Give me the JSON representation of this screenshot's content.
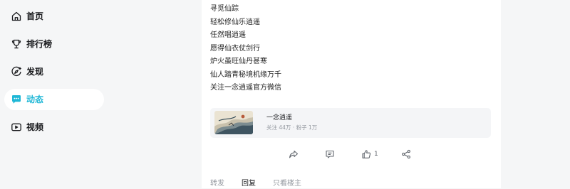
{
  "sidebar": {
    "items": [
      {
        "label": "首页",
        "icon": "home-icon"
      },
      {
        "label": "排行榜",
        "icon": "trophy-icon"
      },
      {
        "label": "发现",
        "icon": "discover-icon"
      },
      {
        "label": "动态",
        "icon": "message-icon",
        "active": true
      },
      {
        "label": "视频",
        "icon": "video-icon"
      }
    ]
  },
  "post": {
    "lines": [
      "寻觅仙踪",
      "轻松修仙乐逍遥",
      "任然唱逍遥",
      "愿得仙衣仗剑行",
      "炉火虽旺仙丹甚寒",
      "仙人踏青秘境机缘万千",
      "关注一念逍遥官方微信"
    ],
    "card": {
      "title": "一念逍遥",
      "stats": "关注 44万 · 粉子 1万"
    },
    "actions": {
      "like_count": "1"
    }
  },
  "tabs": {
    "items": [
      "转发",
      "回复",
      "只看楼主"
    ],
    "active_index": 1
  },
  "colors": {
    "accent": "#1fb7d6",
    "background": "#f5f6f7",
    "panel": "#ffffff"
  }
}
